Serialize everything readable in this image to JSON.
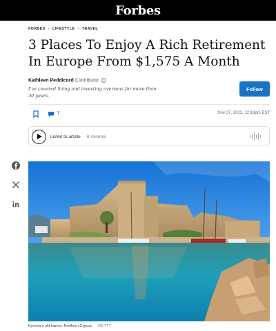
{
  "header": {
    "brand": "Forbes"
  },
  "breadcrumb": [
    "FORBES",
    "LIFESTYLE",
    "TRAVEL"
  ],
  "article": {
    "title": "3 Places To Enjoy A Rich Retirement In Europe From $1,575 A Month",
    "author": {
      "name": "Kathleen Peddicord",
      "role": "Contributor",
      "bio": "I've covered living and investing overseas for more than 30 years."
    },
    "follow_label": "Follow",
    "comment_count": "7",
    "date": "Nov 27, 2023, 12:18pm EST",
    "listen": {
      "label": "Listen to article",
      "duration": "6 minutes"
    },
    "image": {
      "caption": "Kyrenia's old harbor, Northern Cyprus.",
      "credit": "GETTY"
    }
  },
  "share": {
    "facebook_icon": "facebook-icon",
    "x_icon": "x-icon",
    "linkedin_icon": "linkedin-icon"
  },
  "colors": {
    "brand_bar": "#000000",
    "accent": "#1a73c9"
  }
}
